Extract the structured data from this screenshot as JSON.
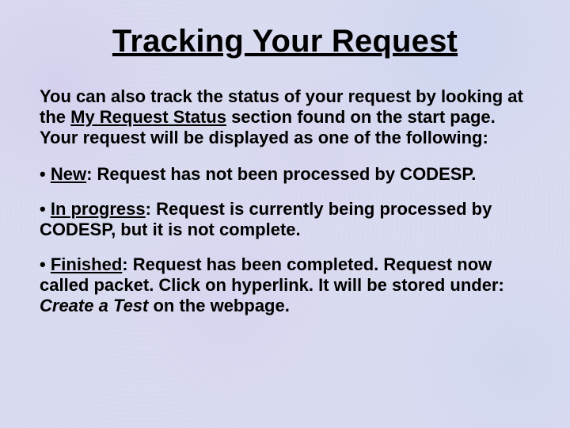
{
  "title": "Tracking Your Request",
  "intro": {
    "before": "You can also track the status of your request by looking at the ",
    "section": "My Request Status",
    "after": " section found on the start page.   Your request will be displayed as one of the following:"
  },
  "bullets": [
    {
      "marker": "• ",
      "label": "New",
      "rest": ":  Request has not been processed by CODESP."
    },
    {
      "marker": "• ",
      "label": "In progress",
      "rest": ": Request is currently being processed by CODESP, but it is not complete."
    },
    {
      "marker": "• ",
      "label": "Finished",
      "rest_before_italic": ":  Request has been completed.  Request now called packet.  Click on hyperlink.  It will be stored under:  ",
      "italic": "Create a Test",
      "rest_after_italic": " on the webpage."
    }
  ]
}
